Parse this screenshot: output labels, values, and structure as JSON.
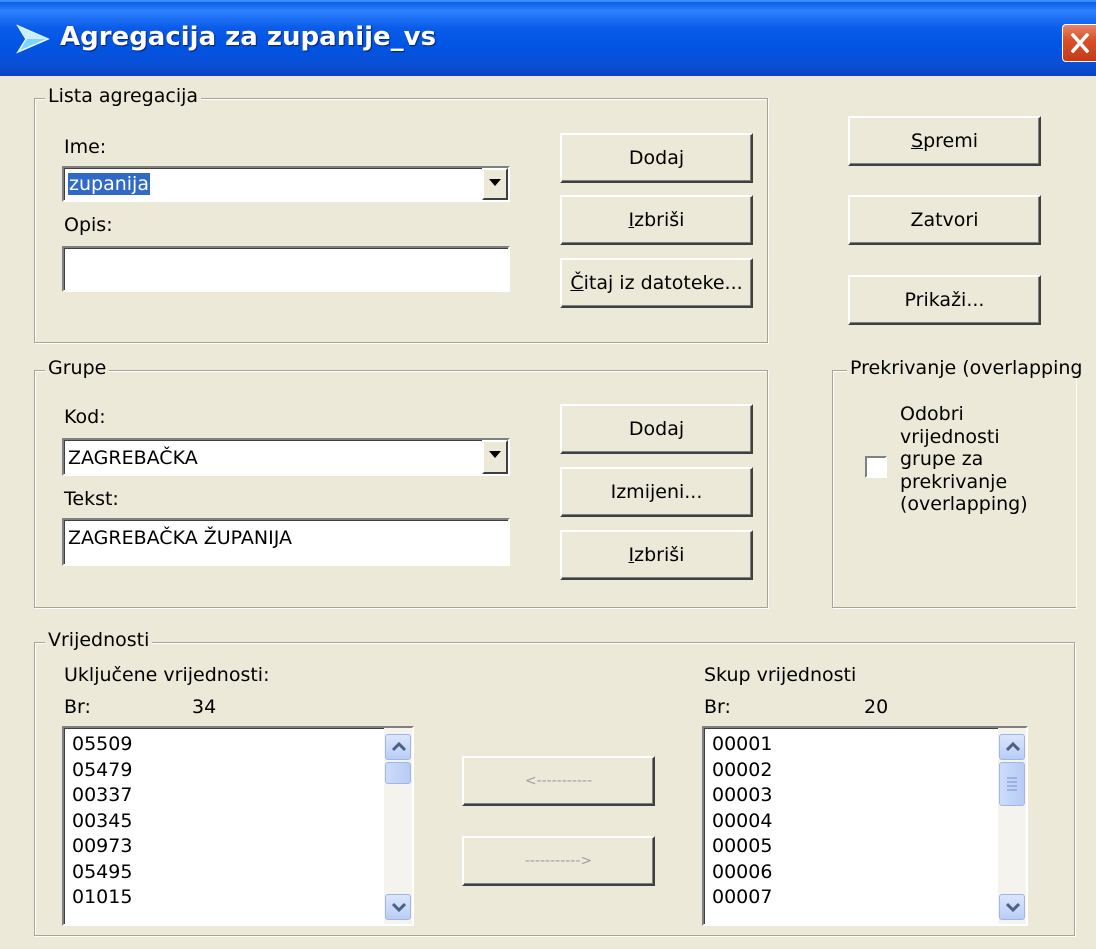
{
  "window": {
    "title": "Agregacija za zupanije_vs",
    "close_icon": "close-icon"
  },
  "lista": {
    "legend": "Lista agregacija",
    "ime_label": "Ime:",
    "ime_value": "zupanija",
    "opis_label": "Opis:",
    "opis_value": "",
    "dodaj_label": "Dodaj",
    "izbrisi_first": "I",
    "izbrisi_rest": "zbriši",
    "citaj_first": "Č",
    "citaj_rest": "itaj iz datoteke..."
  },
  "side_buttons": {
    "spremi_first": "S",
    "spremi_rest": "premi",
    "zatvori_label": "Zatvori",
    "prikazi_label": "Prikaži..."
  },
  "grupe": {
    "legend": "Grupe",
    "kod_label": "Kod:",
    "kod_value": "ZAGREBAČKA",
    "tekst_label": "Tekst:",
    "tekst_value": "ZAGREBAČKA ŽUPANIJA",
    "dodaj_label": "Dodaj",
    "izmijeni_label": "Izmijeni...",
    "izbrisi_first": "I",
    "izbrisi_rest": "zbriši"
  },
  "overlap": {
    "legend": "Prekrivanje (overlapping",
    "checkbox_label_lines": [
      "Odobri",
      "vrijednosti",
      "grupe za",
      "prekrivanje",
      "(overlapping)"
    ],
    "checked": false
  },
  "vrijednosti": {
    "legend": "Vrijednosti",
    "included": {
      "title": "Uključene vrijednosti:",
      "count_label": "Br:",
      "count": "34",
      "items": [
        "05509",
        "05479",
        "00337",
        "00345",
        "00973",
        "05495",
        "01015"
      ]
    },
    "available": {
      "title": "Skup vrijednosti",
      "count_label": "Br:",
      "count": "20",
      "items": [
        "00001",
        "00002",
        "00003",
        "00004",
        "00005",
        "00006",
        "00007"
      ]
    },
    "move_left_label": "<-----------",
    "move_right_label": "----------->"
  }
}
